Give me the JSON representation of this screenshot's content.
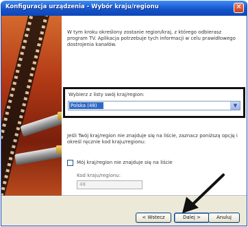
{
  "window": {
    "title": "Konfiguracja urządzenia - Wybór kraju/regionu"
  },
  "intro_text": "W tym kroku określony zostanie region/kraj, z którego odbierasz program TV. Aplikacja potrzebuje tych informacji w celu prawidłowego dostrojenia kanałów.",
  "region_select": {
    "label": "Wybierz z listy swój kraj/region:",
    "value": "Polska (48)"
  },
  "info_text": "Jeśli Twój kraj/region nie znajduje się na liście, zaznacz poniższą opcję i określ ręcznie kod kraju/regionu:",
  "checkbox": {
    "label": "Mój kraj/region nie znajduje się na liście",
    "checked": false
  },
  "country_code": {
    "label": "Kod kraju/regionu:",
    "value": "48"
  },
  "buttons": {
    "back": "< Wstecz",
    "next": "Dalej >",
    "cancel": "Anuluj"
  }
}
